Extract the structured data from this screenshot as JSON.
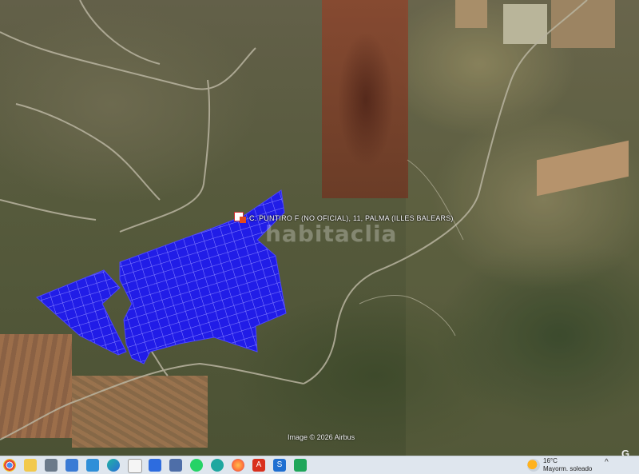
{
  "map": {
    "place_label": "C. PUNTIRO F (NO OFICIAL), 11, PALMA (ILLES BALEARS)",
    "watermark": "habitaclia",
    "imagery_credit": "Image © 2026 Airbus",
    "corner_mark": "G",
    "overlay_color": "#1a14ff",
    "marker_color": "#e34a1c"
  },
  "taskbar": {
    "icons": [
      "chrome-icon",
      "file-explorer-icon",
      "app-icon",
      "photos-icon",
      "edge-icon",
      "document-icon",
      "app-blue-icon",
      "save-icon",
      "whatsapp-icon",
      "app-teal-icon",
      "firefox-icon",
      "acrobat-icon",
      "app-s-icon",
      "app-green-icon"
    ],
    "weather": {
      "temp": "16°C",
      "desc": "Mayorm. soleado",
      "icon": "sun-cloud-icon"
    },
    "tray_chevron": "^"
  }
}
